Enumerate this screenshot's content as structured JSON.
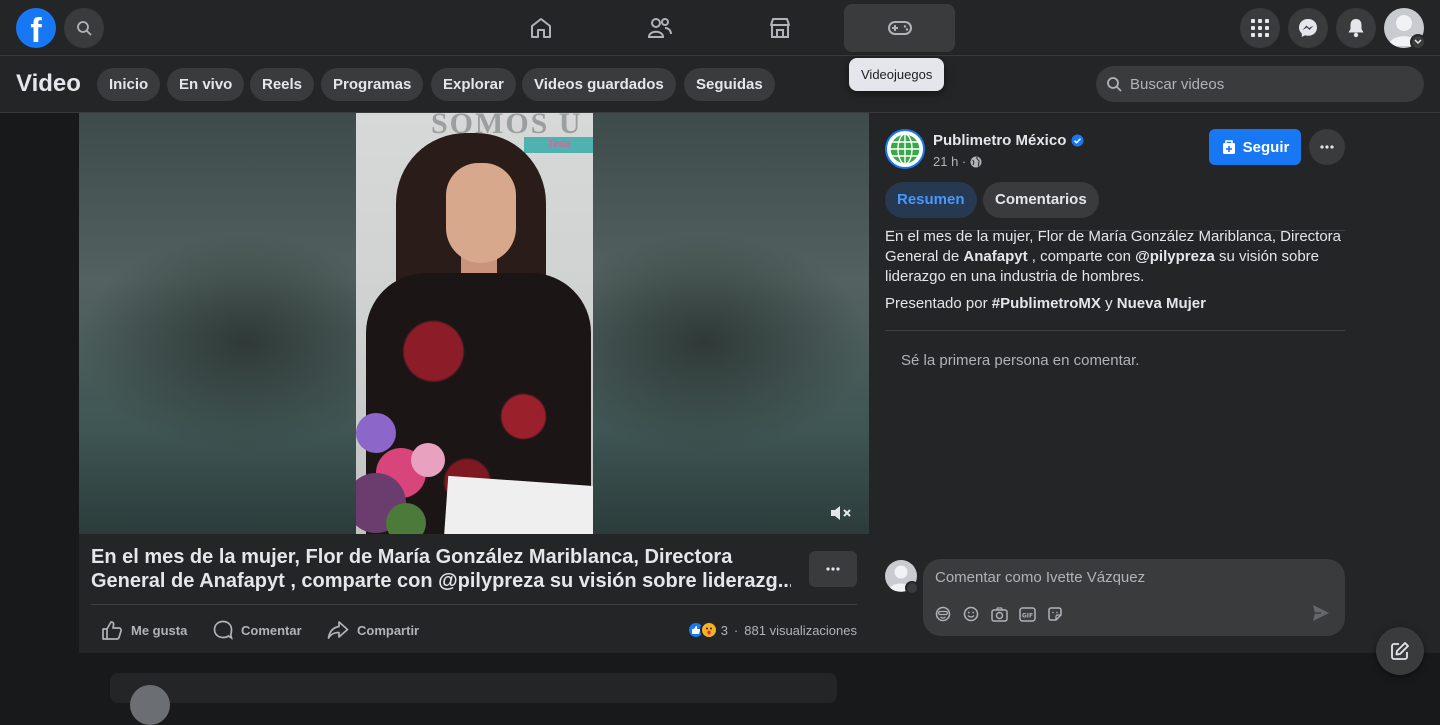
{
  "header": {
    "logo_letter": "f",
    "nav_tabs": [
      {
        "name": "home",
        "icon": "home-icon"
      },
      {
        "name": "friends",
        "icon": "friends-icon"
      },
      {
        "name": "marketplace",
        "icon": "marketplace-icon"
      },
      {
        "name": "gaming",
        "icon": "gamepad-icon",
        "active": true
      }
    ],
    "tooltip": "Videojuegos"
  },
  "subnav": {
    "title": "Video",
    "chips": [
      "Inicio",
      "En vivo",
      "Reels",
      "Programas",
      "Explorar",
      "Videos guardados",
      "Seguidas"
    ],
    "search_placeholder": "Buscar videos"
  },
  "video": {
    "wall_text": "SOMOS U",
    "wall_sign": "Tinta",
    "muted": true
  },
  "post": {
    "title_line1": "En el mes de la mujer, Flor de María González Mariblanca, Directora",
    "title_line2": "General de Anafapyt , comparte con @pilypreza su visión sobre liderazg...",
    "actions": {
      "like": "Me gusta",
      "comment": "Comentar",
      "share": "Compartir"
    },
    "reactions_count": "3",
    "views": "881 visualizaciones"
  },
  "sidebar": {
    "page_name": "Publimetro México",
    "verified": true,
    "time": "21 h ·",
    "follow_label": "Seguir",
    "tabs": [
      "Resumen",
      "Comentarios"
    ],
    "description": {
      "part1": "En el mes de la mujer, Flor de María González Mariblanca, Directora General de ",
      "bold1": "Anafapyt",
      "part2": " , comparte con ",
      "bold2": "@pilypreza",
      "part3": " su visión sobre liderazgo en una industria de hombres."
    },
    "presented": {
      "prefix": "Presentado por ",
      "tag": "#PublimetroMX",
      "joiner": " y ",
      "partner": "Nueva Mujer"
    },
    "empty_comments": "Sé la primera persona en comentar.",
    "comment_placeholder": "Comentar como Ivette Vázquez"
  },
  "colors": {
    "brand": "#1877f2",
    "background": "#18191a",
    "surface": "#242526",
    "chip": "#3a3b3c",
    "active_tab_text": "#4599ff"
  }
}
